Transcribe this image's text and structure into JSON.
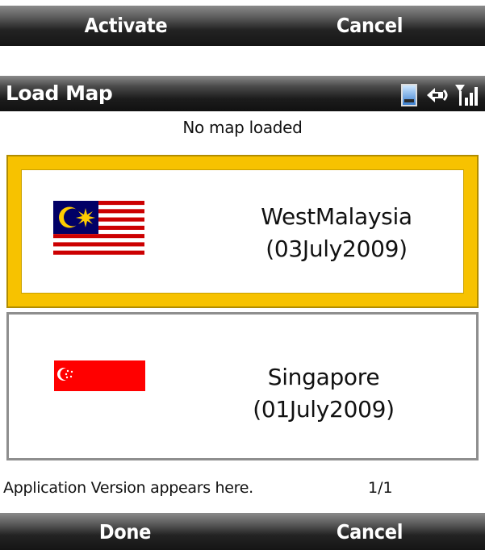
{
  "top_softkeys": {
    "left": "Activate",
    "right": "Cancel"
  },
  "titlebar": {
    "title": "Load Map"
  },
  "status_text": "No map loaded",
  "maps": [
    {
      "name": "WestMalaysia",
      "date": "(03July2009)",
      "selected": true
    },
    {
      "name": "Singapore",
      "date": "(01July2009)",
      "selected": false
    }
  ],
  "footer": {
    "version": "Application Version appears here.",
    "page": "1/1"
  },
  "bottom_softkeys": {
    "left": "Done",
    "right": "Cancel"
  },
  "icons": [
    "device-icon",
    "connectivity-icon",
    "signal-strength-icon",
    "malaysia-flag-icon",
    "singapore-flag-icon"
  ],
  "colors": {
    "selection": "#f7c200",
    "softbar": "#1a1a1a"
  }
}
